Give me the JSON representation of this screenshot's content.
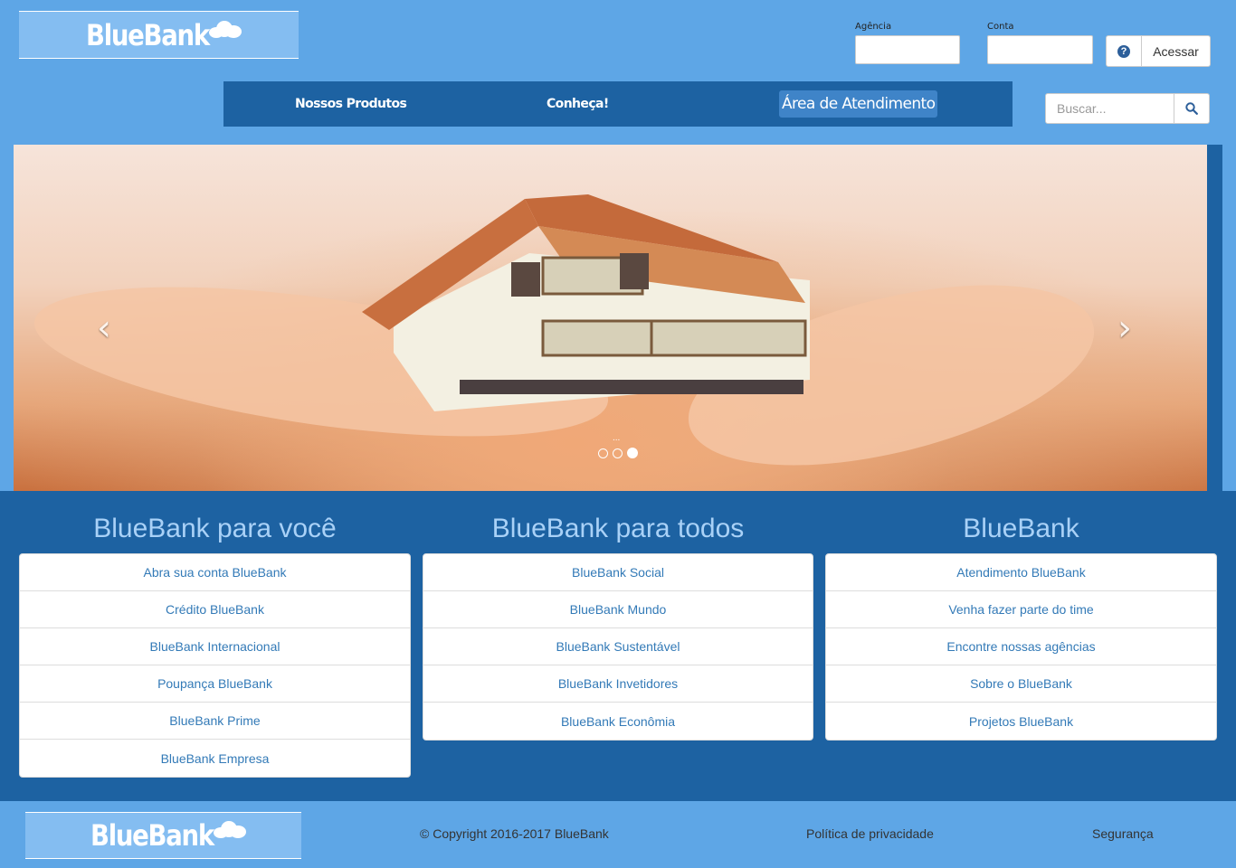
{
  "brand": {
    "name": "BlueBank"
  },
  "login": {
    "agency_label": "Agência",
    "account_label": "Conta",
    "agency_value": "",
    "account_value": "",
    "help_icon": "question-circle-icon",
    "access_label": "Acessar"
  },
  "nav": {
    "items": [
      {
        "label": "Nossos Produtos"
      },
      {
        "label": "Conheça!"
      },
      {
        "label": "Área de Atendimento"
      }
    ]
  },
  "search": {
    "placeholder": "Buscar...",
    "icon": "search-icon"
  },
  "carousel": {
    "caption": "...",
    "slide_count": 3,
    "active_slide": 3,
    "prev_icon": "chevron-left-icon",
    "next_icon": "chevron-right-icon"
  },
  "sections": [
    {
      "title": "BlueBank para você",
      "items": [
        "Abra sua conta BlueBank",
        "Crédito BlueBank",
        "BlueBank Internacional",
        "Poupança BlueBank",
        "BlueBank Prime",
        "BlueBank Empresa"
      ]
    },
    {
      "title": "BlueBank para todos",
      "items": [
        "BlueBank Social",
        "BlueBank Mundo",
        "BlueBank Sustentável",
        "BlueBank Invetidores",
        "BlueBank Econômia"
      ]
    },
    {
      "title": "BlueBank",
      "items": [
        "Atendimento BlueBank",
        "Venha fazer parte do time",
        "Encontre nossas agências",
        "Sobre o BlueBank",
        "Projetos BlueBank"
      ]
    }
  ],
  "footer": {
    "copyright": "© Copyright 2016-2017 BlueBank",
    "privacy": "Política de privacidade",
    "security": "Segurança"
  },
  "colors": {
    "header_bg": "#5ea6e6",
    "nav_bg": "#1d62a2",
    "section_title": "#a9d1f7",
    "link": "#337ab7"
  }
}
